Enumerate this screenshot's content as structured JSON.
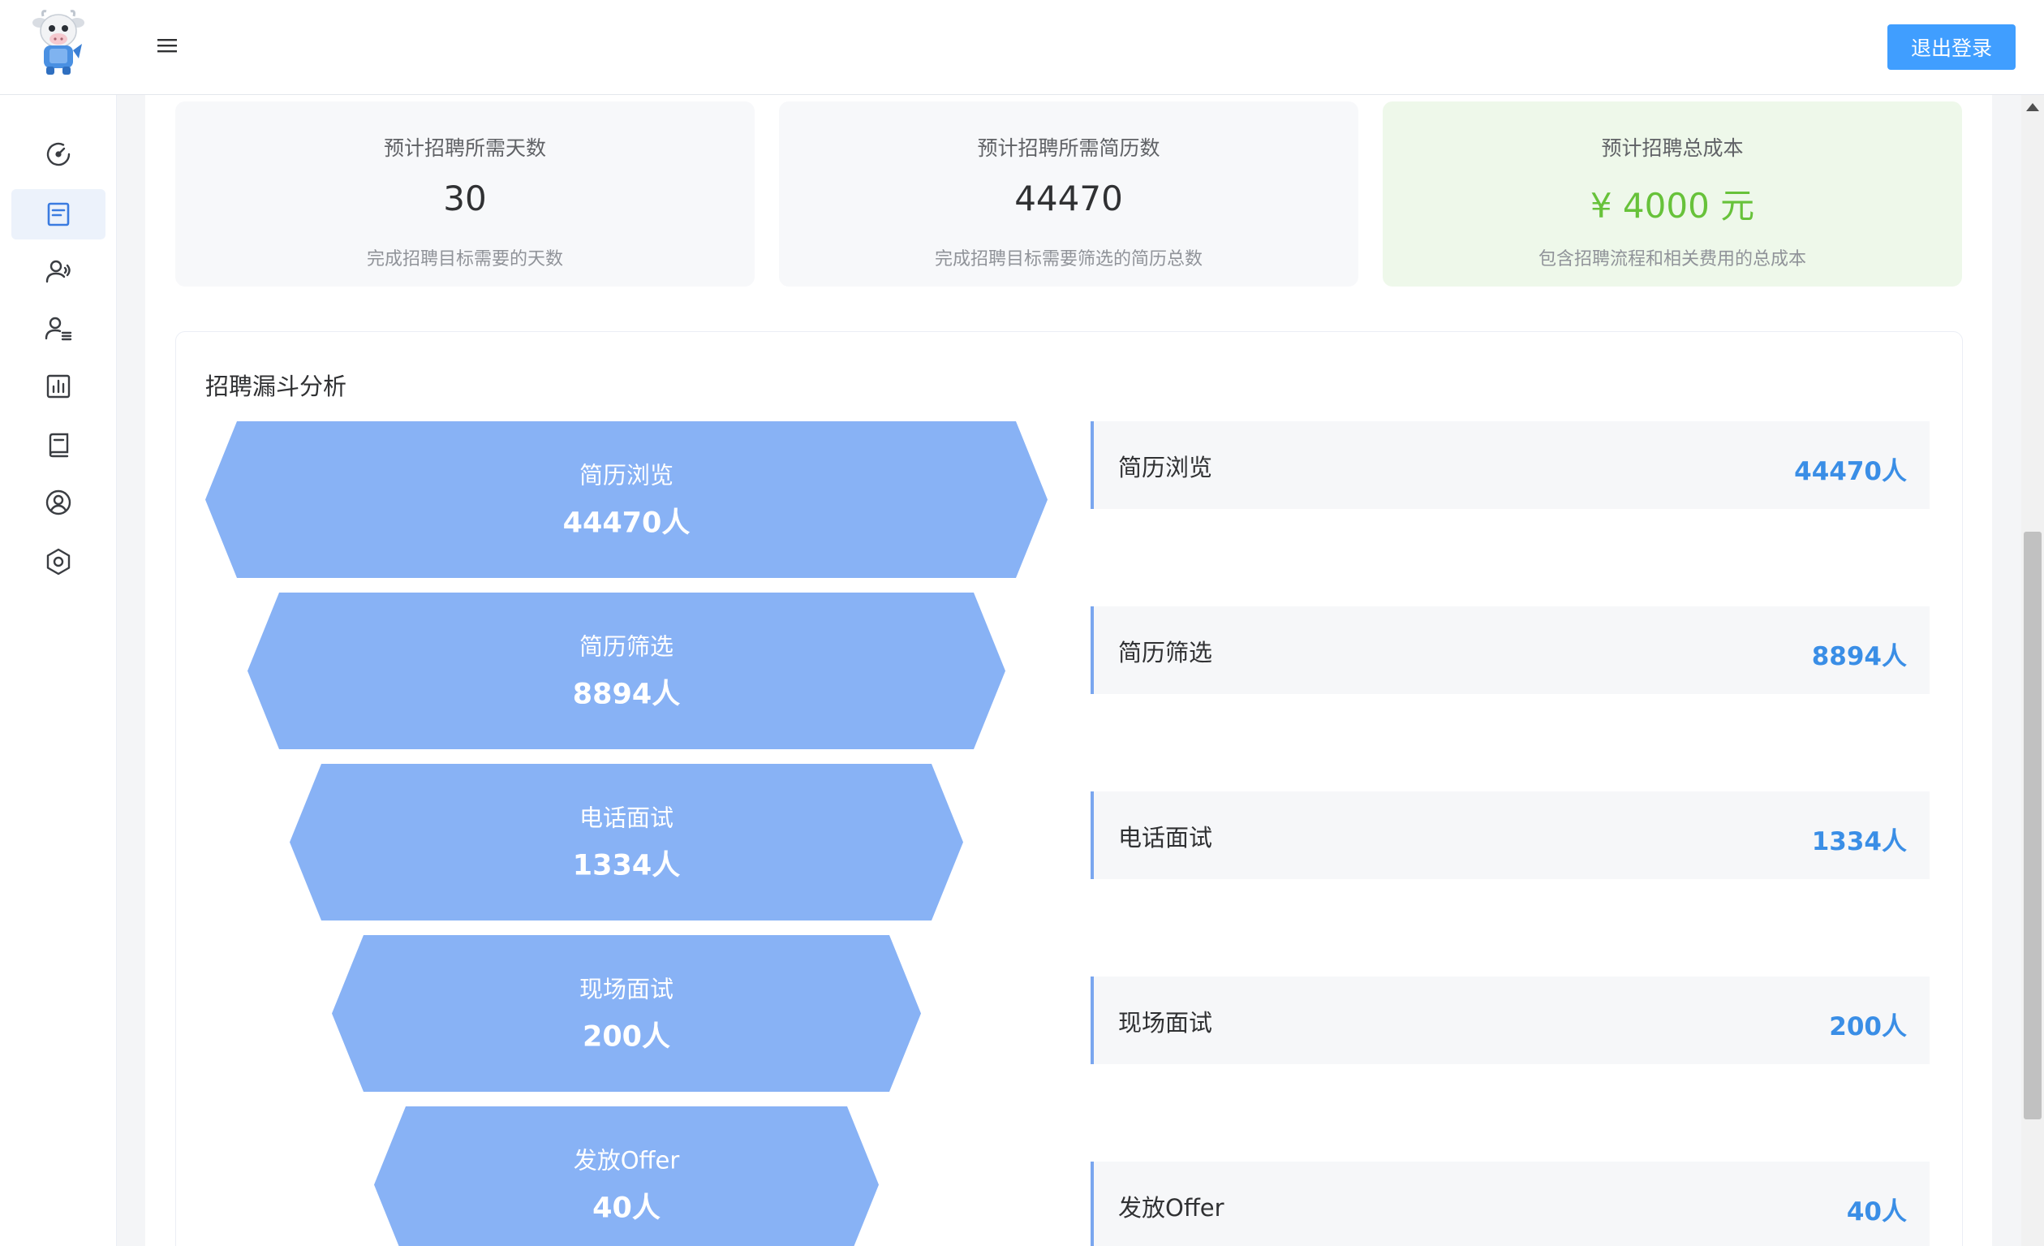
{
  "header": {
    "logo_icon": "cow-mascot-logo",
    "menu_icon": "hamburger-menu-icon",
    "logout_label": "退出登录"
  },
  "sidebar": {
    "items": [
      {
        "icon": "dashboard-gauge-icon",
        "active": false
      },
      {
        "icon": "document-form-icon",
        "active": true
      },
      {
        "icon": "user-voice-icon",
        "active": false
      },
      {
        "icon": "user-list-icon",
        "active": false
      },
      {
        "icon": "bar-chart-icon",
        "active": false
      },
      {
        "icon": "book-icon",
        "active": false
      },
      {
        "icon": "user-circle-icon",
        "active": false
      },
      {
        "icon": "settings-hexagon-icon",
        "active": false
      }
    ]
  },
  "stats": [
    {
      "title": "预计招聘所需天数",
      "value": "30",
      "desc": "完成招聘目标需要的天数",
      "highlight": false
    },
    {
      "title": "预计招聘所需简历数",
      "value": "44470",
      "desc": "完成招聘目标需要筛选的简历总数",
      "highlight": false
    },
    {
      "title": "预计招聘总成本",
      "value": "¥ 4000 元",
      "desc": "包含招聘流程和相关费用的总成本",
      "highlight": true
    }
  ],
  "funnel": {
    "title": "招聘漏斗分析",
    "stages": [
      {
        "name": "简历浏览",
        "count": 44470,
        "label": "44470人"
      },
      {
        "name": "简历筛选",
        "count": 8894,
        "label": "8894人"
      },
      {
        "name": "电话面试",
        "count": 1334,
        "label": "1334人"
      },
      {
        "name": "现场面试",
        "count": 200,
        "label": "200人"
      },
      {
        "name": "发放Offer",
        "count": 40,
        "label": "40人"
      }
    ]
  },
  "colors": {
    "accent": "#409eff",
    "funnel_fill": "#88b2f5",
    "legend_value": "#3a8ee6",
    "cost_green": "#67c23a"
  }
}
